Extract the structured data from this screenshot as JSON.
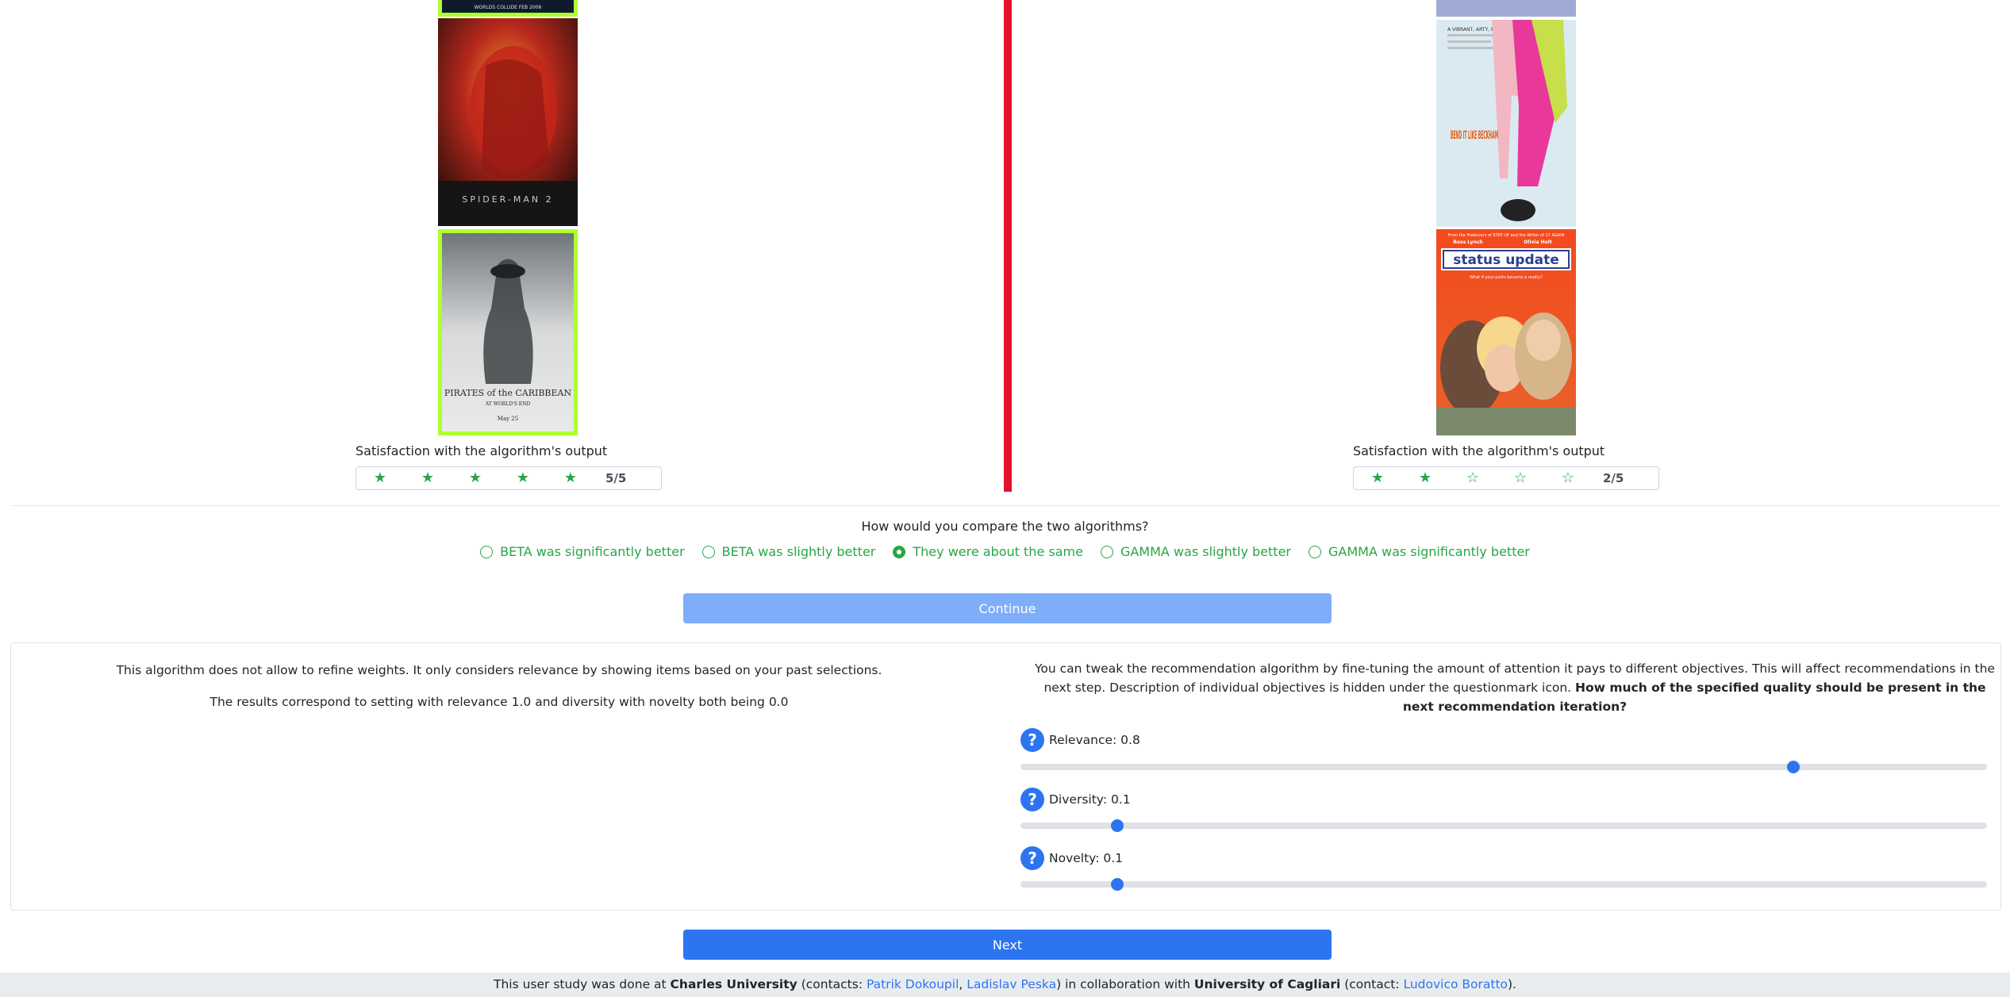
{
  "left_column": {
    "poster_top_text": "WORLDS COLLIDE FEB 2006",
    "poster_spider_title": "SPIDER-MAN 2",
    "poster_pirates_title": "PIRATES of the CARIBBEAN",
    "poster_pirates_subtitle": "AT WORLD'S END",
    "poster_pirates_date": "May 25",
    "satisfaction_label": "Satisfaction with the algorithm's output",
    "rating_filled": 5,
    "rating_text": "5/5"
  },
  "right_column": {
    "poster_bend_quote": "A VIBRANT, ARTY, FEEL-GOOD COMEDY",
    "poster_bend_title": "BEND IT LIKE BECKHAM",
    "poster_status_tagline_top": "From the Producers of STEP UP and the Writer of 17 AGAIN",
    "poster_status_actor1": "Ross Lynch",
    "poster_status_actor2": "Olivia Holt",
    "poster_status_title": "status update",
    "poster_status_sub": "What if your posts became a reality?",
    "satisfaction_label": "Satisfaction with the algorithm's output",
    "rating_filled": 2,
    "rating_text": "2/5"
  },
  "compare": {
    "question": "How would you compare the two algorithms?",
    "options": [
      {
        "label": "BETA was significantly better",
        "selected": false
      },
      {
        "label": "BETA was slightly better",
        "selected": false
      },
      {
        "label": "They were about the same",
        "selected": true
      },
      {
        "label": "GAMMA was slightly better",
        "selected": false
      },
      {
        "label": "GAMMA was significantly better",
        "selected": false
      }
    ]
  },
  "continue_label": "Continue",
  "left_panel": {
    "line1": "This algorithm does not allow to refine weights. It only considers relevance by showing items based on your past selections.",
    "line2": "The results correspond to setting with relevance 1.0 and diversity with novelty both being 0.0"
  },
  "right_panel": {
    "intro": "You can tweak the recommendation algorithm by fine-tuning the amount of attention it pays to different objectives. This will affect recommendations in the next step. Description of individual objectives is hidden under the questionmark icon.",
    "question": "How much of the specified quality should be present in the next recommendation iteration?"
  },
  "sliders": [
    {
      "label": "Relevance: 0.8",
      "value": 0.8
    },
    {
      "label": "Diversity: 0.1",
      "value": 0.1
    },
    {
      "label": "Novelty: 0.1",
      "value": 0.1
    }
  ],
  "help_icon_glyph": "?",
  "next_label": "Next",
  "footer": {
    "part1": "This user study was done at ",
    "univ1": "Charles University",
    "part2": " (contacts: ",
    "contact1": "Patrik Dokoupil",
    "sep": ", ",
    "contact2": "Ladislav Peska",
    "part3": ") in collaboration with ",
    "univ2": "University of Cagliari",
    "part4": " (contact: ",
    "contact3": "Ludovico Boratto",
    "part5": ")."
  },
  "colors": {
    "accent_blue": "#2d74f0",
    "success_green": "#28a745",
    "divider_red": "#e3132c",
    "selected_border": "#adff2f"
  }
}
